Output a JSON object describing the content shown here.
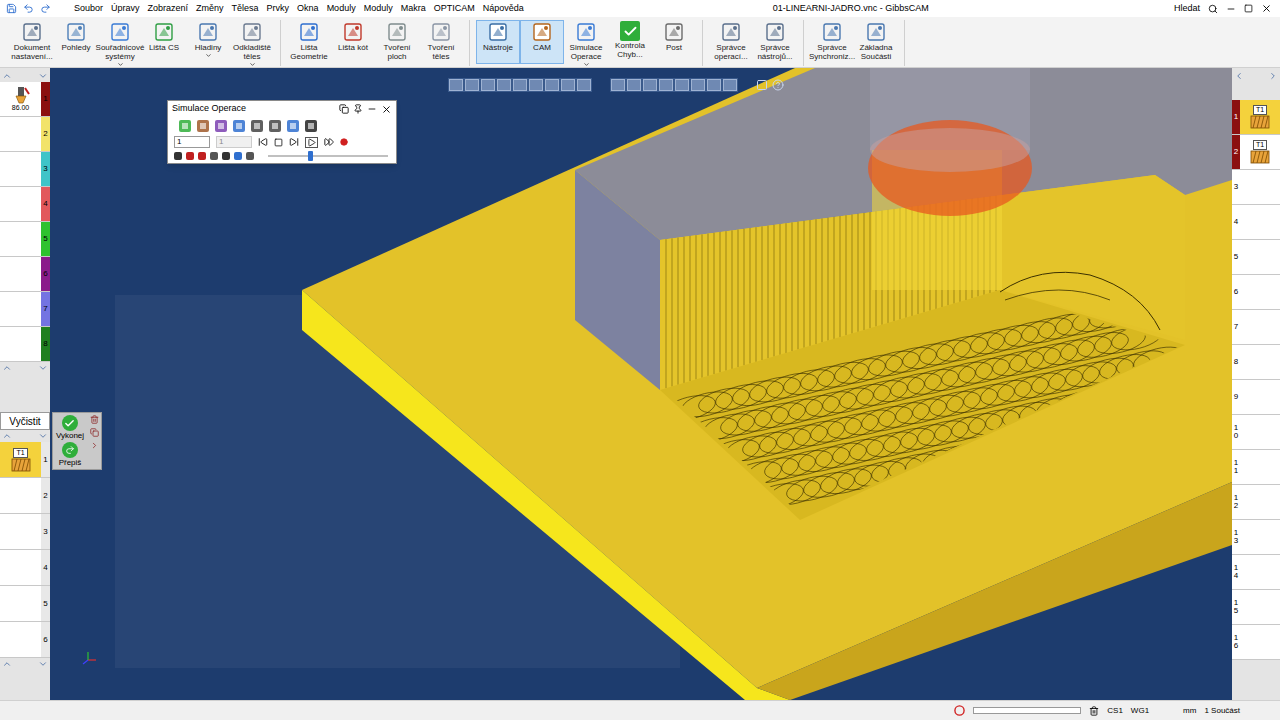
{
  "window": {
    "title": "01-LINEARNI-JADRO.vnc - GibbsCAM"
  },
  "menu": [
    "Soubor",
    "Úpravy",
    "Zobrazení",
    "Změny",
    "Tělesa",
    "Prvky",
    "Okna",
    "Moduly",
    "Moduly",
    "Makra",
    "OPTICAM",
    "Nápověda"
  ],
  "search": {
    "label": "Hledat"
  },
  "ribbon": [
    {
      "items": [
        {
          "label": "Dokument nastavení...",
          "selected": false,
          "has_menu": false
        },
        {
          "label": "Pohledy",
          "selected": false,
          "has_menu": false
        },
        {
          "label": "Souřadnicové systémy",
          "selected": false,
          "has_menu": true
        },
        {
          "label": "Lišta CS",
          "selected": false,
          "has_menu": false
        },
        {
          "label": "Hladiny",
          "selected": false,
          "has_menu": true
        },
        {
          "label": "Odkladiště těles",
          "selected": false,
          "has_menu": true
        }
      ]
    },
    {
      "items": [
        {
          "label": "Lišta Geometrie",
          "selected": false,
          "has_menu": false
        },
        {
          "label": "Lišta kót",
          "selected": false,
          "has_menu": false
        },
        {
          "label": "Tvoření ploch",
          "selected": false,
          "has_menu": false
        },
        {
          "label": "Tvoření těles",
          "selected": false,
          "has_menu": false
        }
      ]
    },
    {
      "items": [
        {
          "label": "Nástroje",
          "selected": true,
          "has_menu": false
        },
        {
          "label": "CAM",
          "selected": true,
          "has_menu": false
        },
        {
          "label": "Simulace Operace",
          "selected": false,
          "has_menu": true
        },
        {
          "label": "Kontrola Chyb...",
          "selected": false,
          "has_menu": false
        },
        {
          "label": "Post",
          "selected": false,
          "has_menu": false
        }
      ]
    },
    {
      "items": [
        {
          "label": "Správce operací...",
          "selected": false,
          "has_menu": false
        },
        {
          "label": "Správce nástrojů...",
          "selected": false,
          "has_menu": false
        }
      ]
    },
    {
      "items": [
        {
          "label": "Správce Synchroniz...",
          "selected": false,
          "has_menu": false
        },
        {
          "label": "Základna Součásti",
          "selected": false,
          "has_menu": false
        }
      ]
    }
  ],
  "tools": [
    {
      "number": "1",
      "color": "#8b1010",
      "label": "86.00"
    },
    {
      "number": "2",
      "color": "#f2e36a",
      "label": ""
    },
    {
      "number": "3",
      "color": "#3fc4c8",
      "label": ""
    },
    {
      "number": "4",
      "color": "#e2585c",
      "label": ""
    },
    {
      "number": "5",
      "color": "#2fc22f",
      "label": ""
    },
    {
      "number": "6",
      "color": "#8a1b8a",
      "label": ""
    },
    {
      "number": "7",
      "color": "#7474e2",
      "label": ""
    },
    {
      "number": "8",
      "color": "#1f7f1f",
      "label": ""
    }
  ],
  "ops_panel": {
    "clear_button": "Vyčistit",
    "run_button": "Vykonej",
    "redo_button": "Přepiš",
    "items": [
      {
        "number": "1",
        "tool": "T1",
        "selected": true
      },
      {
        "number": "2",
        "tool": "",
        "selected": false
      },
      {
        "number": "3",
        "tool": "",
        "selected": false
      },
      {
        "number": "4",
        "tool": "",
        "selected": false
      },
      {
        "number": "5",
        "tool": "",
        "selected": false
      },
      {
        "number": "6",
        "tool": "",
        "selected": false
      }
    ]
  },
  "process_list": [
    {
      "number": "1",
      "tool": "T1",
      "selected": true,
      "color": "#8b1010"
    },
    {
      "number": "2",
      "tool": "T1",
      "selected": false,
      "color": "#8b1010"
    },
    {
      "number": "3",
      "tool": "",
      "selected": false,
      "color": "#ffffff"
    },
    {
      "number": "4",
      "tool": "",
      "selected": false,
      "color": "#ffffff"
    },
    {
      "number": "5",
      "tool": "",
      "selected": false,
      "color": "#ffffff"
    },
    {
      "number": "6",
      "tool": "",
      "selected": false,
      "color": "#ffffff"
    },
    {
      "number": "7",
      "tool": "",
      "selected": false,
      "color": "#ffffff"
    },
    {
      "number": "8",
      "tool": "",
      "selected": false,
      "color": "#ffffff"
    },
    {
      "number": "9",
      "tool": "",
      "selected": false,
      "color": "#ffffff"
    },
    {
      "number": "10",
      "tool": "",
      "selected": false,
      "color": "#ffffff"
    },
    {
      "number": "11",
      "tool": "",
      "selected": false,
      "color": "#ffffff"
    },
    {
      "number": "12",
      "tool": "",
      "selected": false,
      "color": "#ffffff"
    },
    {
      "number": "13",
      "tool": "",
      "selected": false,
      "color": "#ffffff"
    },
    {
      "number": "14",
      "tool": "",
      "selected": false,
      "color": "#ffffff"
    },
    {
      "number": "15",
      "tool": "",
      "selected": false,
      "color": "#ffffff"
    },
    {
      "number": "16",
      "tool": "",
      "selected": false,
      "color": "#ffffff"
    }
  ],
  "simulation": {
    "title": "Simulace Operace",
    "step": "1",
    "step_total": "1",
    "step_total_disabled": true,
    "level": 0.33
  },
  "status_bar": {
    "level": 0,
    "cs": "CS1",
    "wg": "WG1",
    "units": "mm",
    "parts": "1 Součást"
  }
}
